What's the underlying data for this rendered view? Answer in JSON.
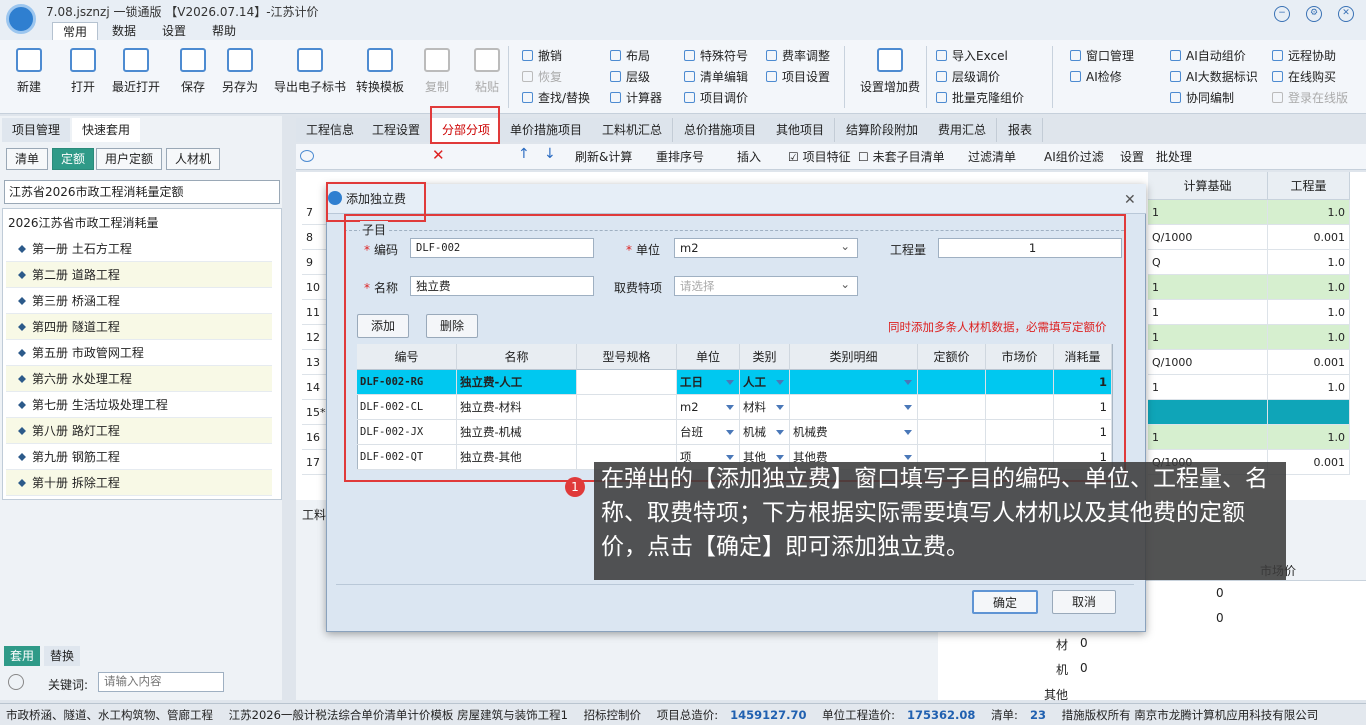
{
  "app": {
    "title": "7.08.jsznzj 一锁通版 【V2026.07.14】-江苏计价",
    "menu_tabs": [
      "常用",
      "数据",
      "设置",
      "帮助"
    ]
  },
  "ribbon": {
    "big_buttons": [
      "新建",
      "打开",
      "最近打开",
      "保存",
      "另存为",
      "导出电子标书",
      "转换模板",
      "复制",
      "粘贴"
    ],
    "small_groups": [
      [
        "撤销",
        "恢复",
        "查找/替换"
      ],
      [
        "布局",
        "层级",
        "计算器"
      ],
      [
        "特殊符号",
        "清单编辑",
        "项目调价"
      ],
      [
        "费率调整",
        "项目设置"
      ]
    ],
    "setting_fee": "设置增加费",
    "import_group": [
      "导入Excel",
      "层级调价",
      "批量克隆组价"
    ],
    "window_group": [
      "窗口管理",
      "AI检修"
    ],
    "ai_group": [
      "AI自动组价",
      "AI大数据标识"
    ],
    "remote_group": [
      "远程协助",
      "在线购买",
      "协同编制",
      "登录在线版"
    ]
  },
  "left": {
    "tabs": [
      "项目管理",
      "快速套用"
    ],
    "buttons": [
      "清单",
      "定额",
      "用户定额",
      "人材机"
    ],
    "combo": "江苏省2026市政工程消耗量定额",
    "tree_root": "2026江苏省市政工程消耗量",
    "tree": [
      "第一册 土石方工程",
      "第二册 道路工程",
      "第三册 桥涵工程",
      "第四册 隧道工程",
      "第五册 市政管网工程",
      "第六册 水处理工程",
      "第七册 生活垃圾处理工程",
      "第八册 路灯工程",
      "第九册 钢筋工程",
      "第十册 拆除工程"
    ],
    "bottom_tabs": [
      "套用",
      "替换"
    ],
    "keyword_label": "关键词:",
    "keyword_placeholder": "请输入内容"
  },
  "main": {
    "tabs": [
      "工程信息",
      "工程设置",
      "分部分项",
      "单价措施项目",
      "工料机汇总",
      "总价措施项目",
      "其他项目",
      "结算阶段附加",
      "费用汇总",
      "报表"
    ],
    "toolbar": [
      "刷新&计算",
      "重排序号",
      "插入",
      "项目特征",
      "未套子目清单",
      "过滤清单",
      "AI组价过滤",
      "设置",
      "批处理"
    ],
    "grid_headers": [
      "计算基础",
      "工程量"
    ],
    "row_nums": [
      "7",
      "8",
      "9",
      "10",
      "11",
      "12",
      "13",
      "14",
      "15*",
      "16",
      "17"
    ],
    "calc_base": [
      "1",
      "Q/1000",
      "Q",
      "1",
      "1",
      "1",
      "Q/1000",
      "1",
      "",
      "1",
      "Q/1000"
    ],
    "qty": [
      "1.0",
      "0.001",
      "1.0",
      "1.0",
      "1.0",
      "1.0",
      "0.001",
      "1.0",
      "",
      "1.0",
      "0.001"
    ],
    "lower_labels": [
      "材",
      "机",
      "其他"
    ],
    "lower_vals": [
      "0",
      "0",
      "0",
      "0"
    ],
    "lower_header": "市场价",
    "lower_tab": "工料"
  },
  "dialog": {
    "title": "添加独立费",
    "section": "子目",
    "code_label": "编码",
    "code": "DLF-002",
    "unit_label": "单位",
    "unit": "m2",
    "qty_label": "工程量",
    "qty": "1",
    "name_label": "名称",
    "name": "独立费",
    "fee_label": "取费特项",
    "fee_placeholder": "请选择",
    "add": "添加",
    "delete": "删除",
    "hint": "同时添加多条人材机数据，必需填写定额价",
    "cols": [
      "编号",
      "名称",
      "型号规格",
      "单位",
      "类别",
      "类别明细",
      "定额价",
      "市场价",
      "消耗量"
    ],
    "rows": [
      [
        "DLF-002-RG",
        "独立费-人工",
        "",
        "工日",
        "人工",
        "",
        "",
        "",
        "1"
      ],
      [
        "DLF-002-CL",
        "独立费-材料",
        "",
        "m2",
        "材料",
        "",
        "",
        "",
        "1"
      ],
      [
        "DLF-002-JX",
        "独立费-机械",
        "",
        "台班",
        "机械",
        "机械费",
        "",
        "",
        "1"
      ],
      [
        "DLF-002-QT",
        "独立费-其他",
        "",
        "项",
        "其他",
        "其他费",
        "",
        "",
        "1"
      ]
    ],
    "ok": "确定",
    "cancel": "取消"
  },
  "callout": {
    "badge": "1",
    "text": "在弹出的【添加独立费】窗口填写子目的编码、单位、工程量、名称、取费特项；下方根据实际需要填写人材机以及其他费的定额价，点击【确定】即可添加独立费。"
  },
  "status": {
    "items": [
      "市政桥涵、隧道、水工构筑物、管廊工程",
      "江苏2026一般计税法综合单价清单计价模板 房屋建筑与装饰工程1",
      "招标控制价",
      "项目总造价:",
      "1459127.70",
      "单位工程造价:",
      "175362.08",
      "清单:",
      "23",
      "措施版权所有 南京市龙腾计算机应用科技有限公司"
    ]
  },
  "colors": {
    "accent": "#2f9a88",
    "highlight": "#00c8f0",
    "annotation": "#e03a3a"
  }
}
